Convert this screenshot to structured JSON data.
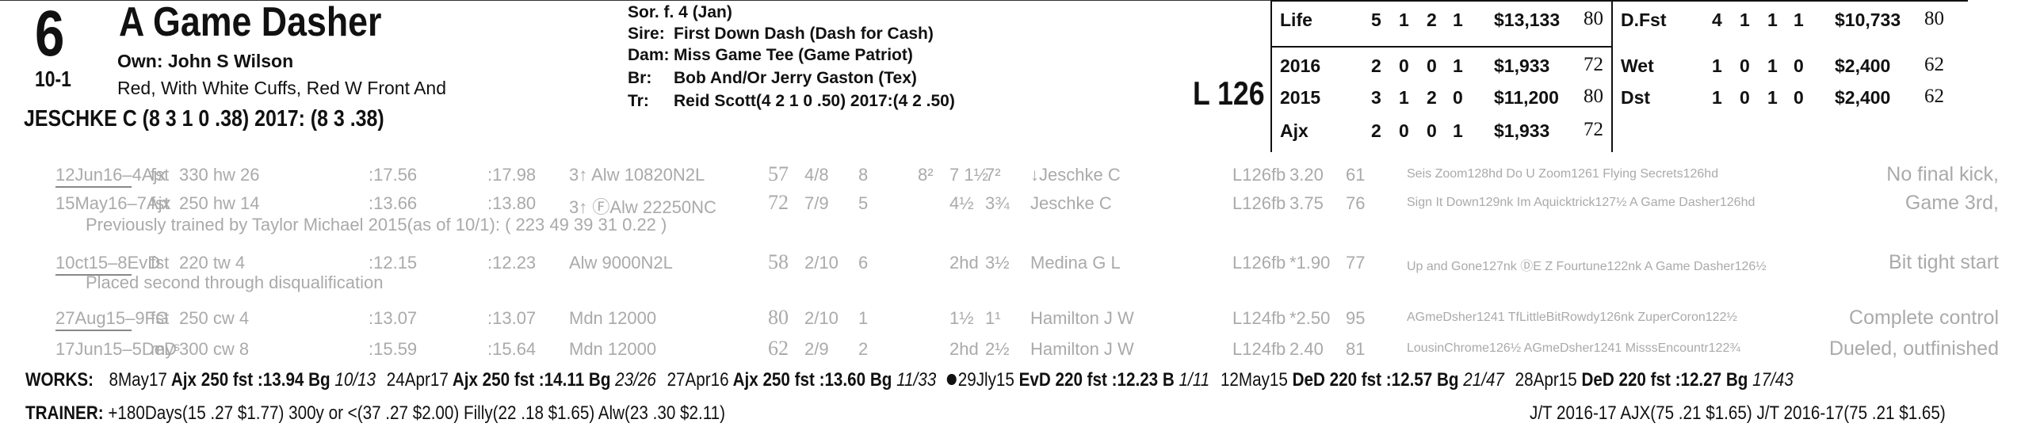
{
  "header": {
    "post_position": "6",
    "horse_name": "A Game Dasher",
    "owner": "Own: John S Wilson",
    "morning_line": "10-1",
    "silks": "Red, With White Cuffs, Red W Front And",
    "jockey": "JESCHKE C (8 3 1 0 .38) 2017: (8 3 .38)",
    "pedigree": {
      "sex_age": "Sor. f. 4 (Jan)",
      "sire_label": "Sire:",
      "sire": "First Down Dash (Dash for Cash)",
      "dam_label": "Dam:",
      "dam": "Miss Game Tee (Game Patriot)",
      "breeder_label": "Br:",
      "breeder": "Bob And/Or Jerry Gaston (Tex)",
      "trainer_label": "Tr:",
      "trainer": "Reid Scott(4 2 1 0 .50)  2017:(4 2 .50)"
    },
    "weight": "L 126"
  },
  "stats": {
    "left": [
      {
        "label": "Life",
        "starts": "5",
        "w": "1",
        "p": "2",
        "s": "1",
        "earn": "$13,133",
        "speed": "80"
      },
      {
        "label": "2016",
        "starts": "2",
        "w": "0",
        "p": "0",
        "s": "1",
        "earn": "$1,933",
        "speed": "72"
      },
      {
        "label": "2015",
        "starts": "3",
        "w": "1",
        "p": "2",
        "s": "0",
        "earn": "$11,200",
        "speed": "80"
      },
      {
        "label": "Ajx",
        "starts": "2",
        "w": "0",
        "p": "0",
        "s": "1",
        "earn": "$1,933",
        "speed": "72"
      }
    ],
    "right": [
      {
        "label": "D.Fst",
        "starts": "4",
        "w": "1",
        "p": "1",
        "s": "1",
        "earn": "$10,733",
        "speed": "80"
      },
      {
        "label": "Wet",
        "starts": "1",
        "w": "0",
        "p": "1",
        "s": "0",
        "earn": "$2,400",
        "speed": "62"
      },
      {
        "label": "Dst",
        "starts": "1",
        "w": "0",
        "p": "1",
        "s": "0",
        "earn": "$2,400",
        "speed": "62"
      }
    ]
  },
  "past_performances": [
    {
      "date": "12Jun16–4Ajx",
      "cond": "fst",
      "dist": "330 hw 26",
      "t1": ":17.56",
      "t2": ":17.98",
      "race": "3↑ Alw 10820N2L",
      "spd": "57",
      "pp": "4/8",
      "st": "8",
      "c1": "8²",
      "str": "7 1½",
      "fin": "7²",
      "jockey": "↓Jeschke C",
      "wt": "L126fb",
      "odds": "3.20",
      "fig": "61",
      "top3": "Seis Zoom128hd Do U Zoom1261 Flying Secrets126hd",
      "comment": "No final kick,"
    },
    {
      "date": "15May16–7Ajx",
      "cond": "fst",
      "dist": "250 hw 14",
      "t1": ":13.66",
      "t2": ":13.80",
      "race": "3↑ ⒻAlw 22250NC",
      "spd": "72",
      "pp": "7/9",
      "st": "5",
      "c1": "",
      "str": "4½",
      "fin": "3¾",
      "jockey": "Jeschke C",
      "wt": "L126fb",
      "odds": "3.75",
      "fig": "76",
      "top3": "Sign It Down129nk Im Aquicktrick127½ A Game Dasher126hd",
      "comment": "Game 3rd,"
    },
    {
      "date": "10ct15–8EvD",
      "cond": "fst",
      "dist": "220 tw 4",
      "t1": ":12.15",
      "t2": ":12.23",
      "race": "Alw 9000N2L",
      "spd": "58",
      "pp": "2/10",
      "st": "6",
      "c1": "",
      "str": "2hd",
      "fin": "3½",
      "jockey": "Medina G L",
      "wt": "L126fb",
      "odds": "*1.90",
      "fig": "77",
      "top3": "Up and Gone127nk ⒹE Z Fourtune122nk A Game Dasher126½",
      "comment": "Bit tight start"
    },
    {
      "date": "27Aug15–9FG",
      "cond": "fst",
      "dist": "250 cw 4",
      "t1": ":13.07",
      "t2": ":13.07",
      "race": "Mdn 12000",
      "spd": "80",
      "pp": "2/10",
      "st": "1",
      "c1": "",
      "str": "1½",
      "fin": "1¹",
      "jockey": "Hamilton J W",
      "wt": "L124fb",
      "odds": "*2.50",
      "fig": "95",
      "top3": "AGmeDsher1241 TfLittleBitRowdy126nk ZuperCoron122½",
      "comment": "Complete control"
    },
    {
      "date": "17Jun15–5DeD",
      "cond": "myˢ",
      "dist": "300 cw 8",
      "t1": ":15.59",
      "t2": ":15.64",
      "race": "Mdn 12000",
      "spd": "62",
      "pp": "2/9",
      "st": "2",
      "c1": "",
      "str": "2hd",
      "fin": "2½",
      "jockey": "Hamilton J W",
      "wt": "L124fb",
      "odds": "2.40",
      "fig": "81",
      "top3": "LousinChrome126½ AGmeDsher1241 MisssEncountr122¾",
      "comment": "Dueled, outfinished"
    }
  ],
  "notes": {
    "previously_trained": "Previously trained by Taylor Michael 2015(as of 10/1): ( 223 49 39 31 0.22 )",
    "dq": "Placed second through disqualification"
  },
  "works": {
    "label": "WORKS:",
    "entries": [
      {
        "date": "8May17",
        "track": "Ajx",
        "dist": "250 fst",
        "time": ":13.94 Bg",
        "rank": "10/13",
        "bullet": false
      },
      {
        "date": "24Apr17",
        "track": "Ajx",
        "dist": "250 fst",
        "time": ":14.11 Bg",
        "rank": "23/26",
        "bullet": false
      },
      {
        "date": "27Apr16",
        "track": "Ajx",
        "dist": "250 fst",
        "time": ":13.60 Bg",
        "rank": "11/33",
        "bullet": false
      },
      {
        "date": "29Jly15",
        "track": "EvD",
        "dist": "220 fst",
        "time": ":12.23 B",
        "rank": "1/11",
        "bullet": true
      },
      {
        "date": "12May15",
        "track": "DeD",
        "dist": "220 fst",
        "time": ":12.57 Bg",
        "rank": "21/47",
        "bullet": false
      },
      {
        "date": "28Apr15",
        "track": "DeD",
        "dist": "220 fst",
        "time": ":12.27 Bg",
        "rank": "17/43",
        "bullet": false
      }
    ]
  },
  "trainer_stats": {
    "label": "TRAINER:",
    "text": "+180Days(15 .27 $1.77) 300y or <(37 .27 $2.00) Filly(22 .18 $1.65) Alw(23 .30 $2.11)",
    "jt": "J/T 2016-17 AJX(75 .21 $1.65)  J/T 2016-17(75 .21 $1.65)"
  }
}
